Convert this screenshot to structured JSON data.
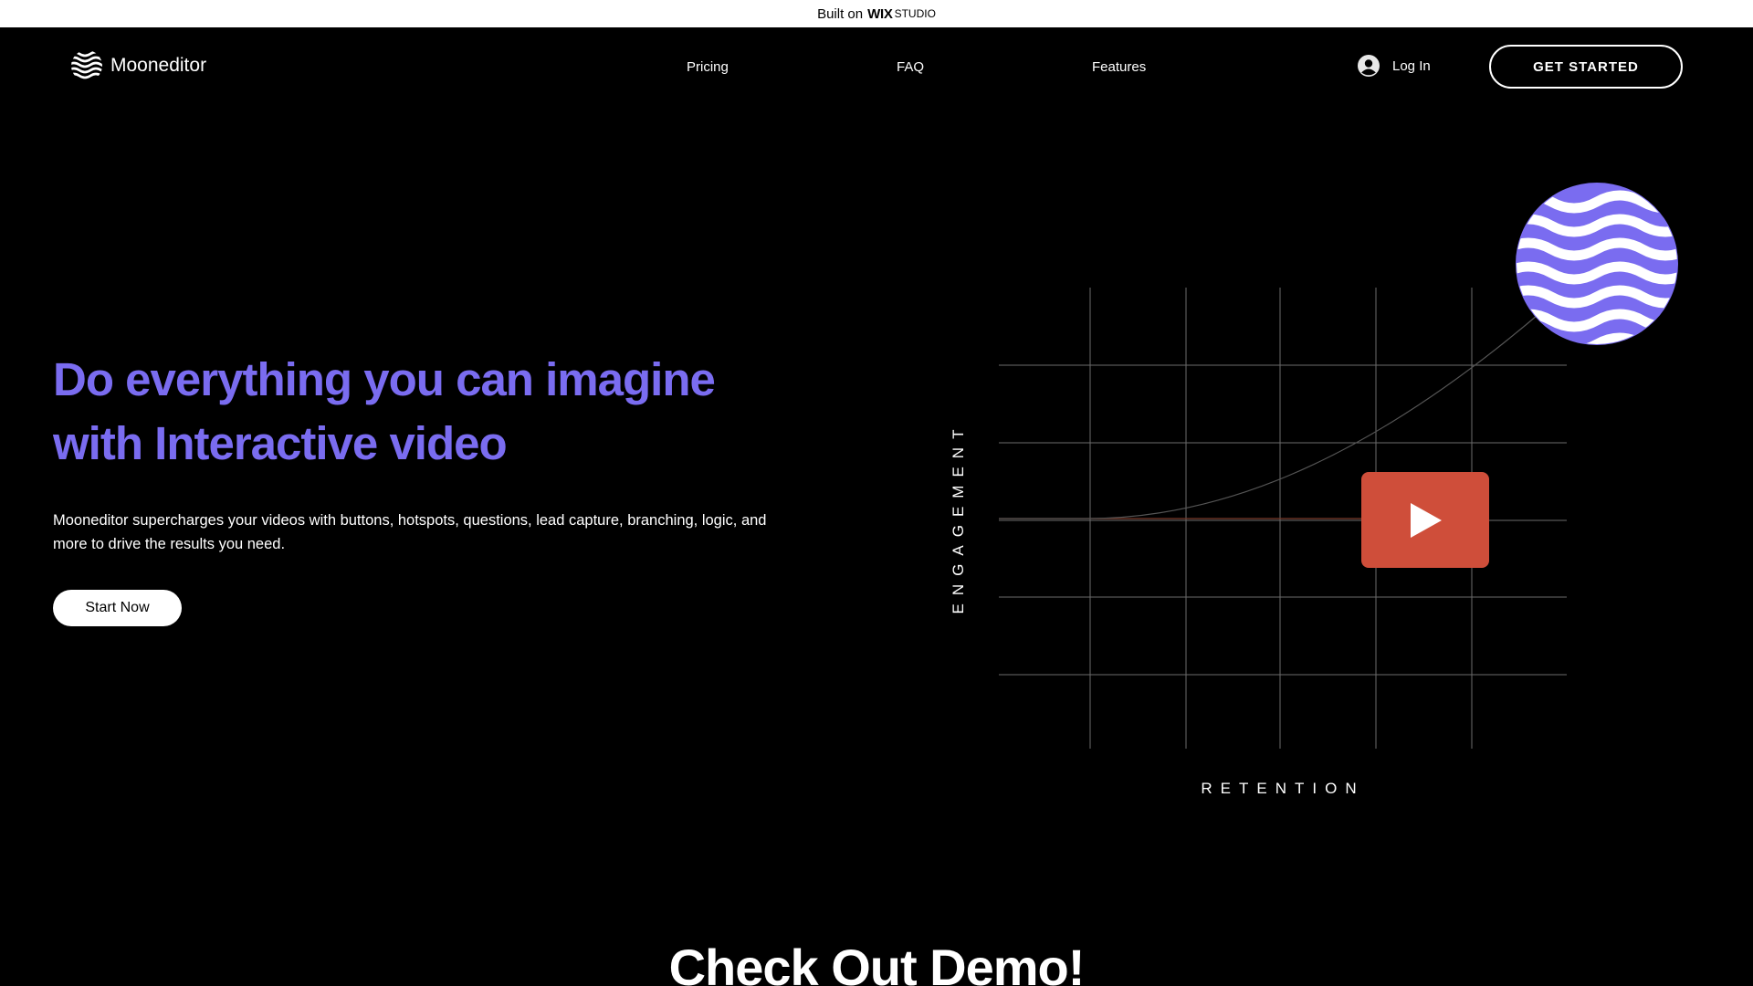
{
  "wix_bar": {
    "prefix": "Built on",
    "brand": "WIX",
    "brand_suffix": "STUDIO"
  },
  "nav": {
    "brand": "Mooneditor",
    "links": [
      "Pricing",
      "FAQ",
      "Features"
    ],
    "login": "Log In",
    "cta": "GET STARTED"
  },
  "hero": {
    "title_line1": "Do everything you can imagine",
    "title_line2": "with Interactive video",
    "description_line1": "Mooneditor supercharges your videos with buttons, hotspots, questions, lead capture, branching, logic, and",
    "description_line2": "more to drive the results you need.",
    "button": "Start Now"
  },
  "graphic": {
    "y_label": "ENGAGEMENT",
    "x_label": "RETENTION",
    "play_color": "#cf4e3a",
    "badge_color": "#7a6cf0"
  },
  "demo": {
    "title": "Check Out Demo!"
  },
  "colors": {
    "accent": "#7a6cf0",
    "background": "#000000"
  }
}
